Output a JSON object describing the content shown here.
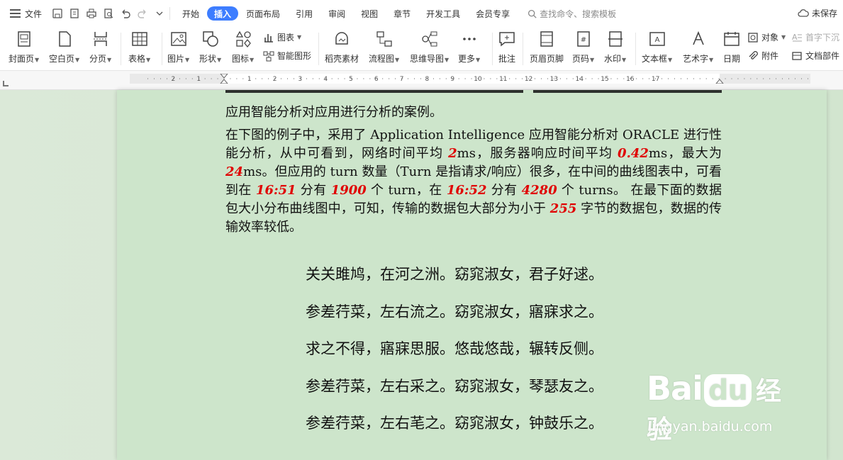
{
  "menu": {
    "file_label": "文件",
    "tabs": [
      "开始",
      "插入",
      "页面布局",
      "引用",
      "审阅",
      "视图",
      "章节",
      "开发工具",
      "会员专享"
    ],
    "active_tab": "插入",
    "search_placeholder": "查找命令、搜索模板",
    "unsaved_label": "未保存"
  },
  "ribbon": {
    "cover_page": "封面页",
    "blank_page": "空白页",
    "page_break": "分页",
    "table": "表格",
    "picture": "图片",
    "shape": "形状",
    "icon": "图标",
    "chart": "图表",
    "smart_art": "智能图形",
    "daoke_material": "稻壳素材",
    "flowchart": "流程图",
    "mind_map": "思维导图",
    "more": "更多",
    "comment": "批注",
    "header_footer": "页眉页脚",
    "page_number": "页码",
    "watermark": "水印",
    "text_box": "文本框",
    "word_art": "艺术字",
    "date": "日期",
    "object": "对象",
    "drop_cap": "首字下沉",
    "attachment": "附件",
    "doc_parts": "文档部件"
  },
  "ruler": {
    "left_ticks": [
      "2",
      "1"
    ],
    "right_ticks": [
      "1",
      "2",
      "3",
      "4",
      "5",
      "6",
      "7",
      "8",
      "9",
      "10",
      "11",
      "12",
      "13",
      "14",
      "15",
      "16",
      "17"
    ]
  },
  "document": {
    "line1": "应用智能分析对应用进行分析的案例。",
    "p2": {
      "t1": "在下图的例子中，采用了 Application Intelligence 应用智能分析对 ORACLE 进行性能分析，从中可看到，网络时间平均 ",
      "n1": "2",
      "t2": "ms，服务器响应时间平均 ",
      "n2": "0.42",
      "t3": "ms，最大为 ",
      "n3": "24",
      "t4": "ms。但应用的 turn 数量（Turn 是指请求/响应）很多，在中间的曲线图表中，可看到在 ",
      "n4": "16:51",
      "t5": " 分有 ",
      "n5": "1900",
      "t6": " 个 turn，在 ",
      "n6": "16:52",
      "t7": " 分有 ",
      "n7": "4280",
      "t8": " 个 turns。 在最下面的数据包大小分布曲线图中，可知，传输的数据包大部分为小于 ",
      "n8": "255",
      "t9": " 字节的数据包，数据的传输效率较低。"
    },
    "poem": [
      "关关雎鸠，在河之洲。窈窕淑女，君子好逑。",
      "参差荇菜，左右流之。窈窕淑女，寤寐求之。",
      "求之不得，寤寐思服。悠哉悠哉，辗转反侧。",
      "参差荇菜，左右采之。窈窕淑女，琴瑟友之。",
      "参差荇菜，左右芼之。窈窕淑女，钟鼓乐之。"
    ]
  },
  "watermark": {
    "brand_bai": "Bai",
    "brand_du": "du",
    "brand_cn": "经验",
    "url": "jingyan.baidu.com"
  },
  "colors": {
    "accent": "#3d7dff",
    "page_bg": "#cde5cb",
    "highlight": "#e00000"
  }
}
